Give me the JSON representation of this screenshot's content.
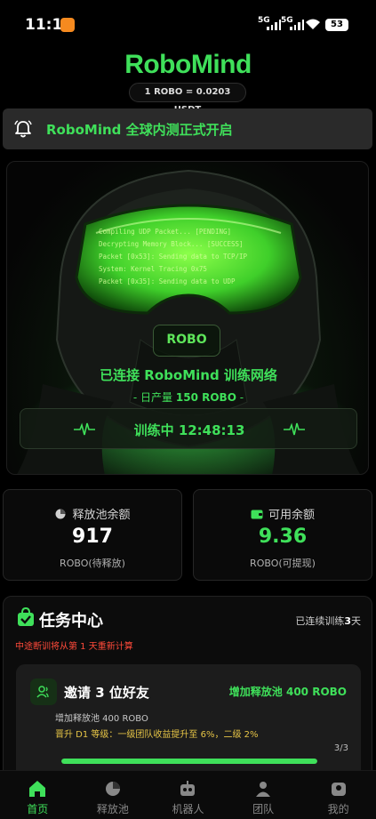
{
  "status_bar": {
    "time": "11:11",
    "signal_1": "5G",
    "signal_2": "5G",
    "battery": "53"
  },
  "header": {
    "logo": "RoboMind",
    "rate": "1 ROBO = 0.0203 USDT"
  },
  "notice": {
    "text": "RoboMind 全球内测正式开启"
  },
  "hero": {
    "code_lines": [
      "Compiling UDP Packet... [PENDING]",
      "Decrypting Memory Block... [SUCCESS]",
      "Packet [0x53]: Sending data to TCP/IP",
      "System: Kernel Tracing 0x75",
      "Packet [0x35]: Sending data to UDP"
    ],
    "badge": "ROBO",
    "connected": "已连接 RoboMind 训练网络",
    "daily_prefix": "- 日产量",
    "daily_value": "150 ROBO",
    "daily_suffix": "-",
    "training_label": "训练中",
    "training_time": "12:48:13"
  },
  "release_pool": {
    "title": "释放池余额",
    "value": "917",
    "sub": "ROBO(待释放)"
  },
  "available": {
    "title": "可用余额",
    "value": "9.36",
    "sub": "ROBO(可提现)",
    "value_color": "#3fe05a"
  },
  "tasks": {
    "title": "任务中心",
    "streak_prefix": "已连续训练",
    "streak_days": "3",
    "streak_suffix": "天",
    "reset_note": "中途断训将从第 1 天重新计算",
    "item": {
      "title": "邀请 3 位好友",
      "reward": "增加释放池 400 ROBO",
      "desc": "增加释放池 400 ROBO",
      "upgrade": "晋升 D1 等级：一级团队收益提升至 6%，二级 2%",
      "count": "3/3",
      "progress": 1.0
    }
  },
  "nav": {
    "items": [
      {
        "label": "首页",
        "icon": "home-icon",
        "active": true
      },
      {
        "label": "释放池",
        "icon": "pool-icon",
        "active": false
      },
      {
        "label": "机器人",
        "icon": "robot-icon",
        "active": false
      },
      {
        "label": "团队",
        "icon": "team-icon",
        "active": false
      },
      {
        "label": "我的",
        "icon": "profile-icon",
        "active": false
      }
    ]
  },
  "colors": {
    "accent": "#3fe05a",
    "warning": "#ff4a3a",
    "gold": "#e6c446",
    "background": "#000000"
  }
}
